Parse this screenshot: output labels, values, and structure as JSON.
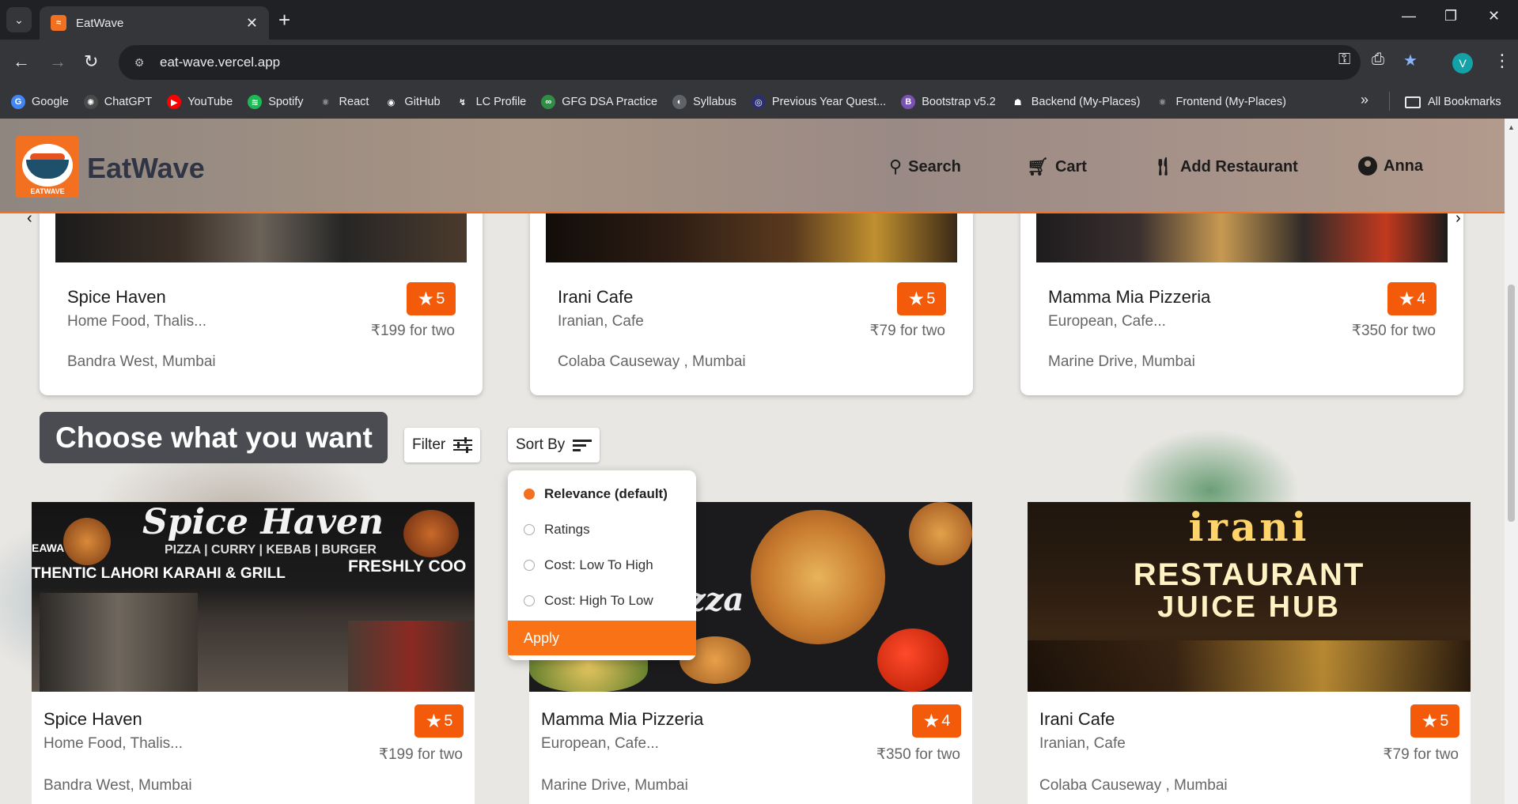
{
  "browser": {
    "tab_title": "EatWave",
    "url": "eat-wave.vercel.app",
    "profile_initial": "V",
    "bookmarks": [
      {
        "label": "Google",
        "color": "#4285f4",
        "glyph": "G"
      },
      {
        "label": "ChatGPT",
        "color": "#4a4a4a",
        "glyph": "✺"
      },
      {
        "label": "YouTube",
        "color": "#ff0000",
        "glyph": "▶"
      },
      {
        "label": "Spotify",
        "color": "#1db954",
        "glyph": "≋"
      },
      {
        "label": "React",
        "color": "#35363a",
        "glyph": "⚛"
      },
      {
        "label": "GitHub",
        "color": "#35363a",
        "glyph": "◉"
      },
      {
        "label": "LC Profile",
        "color": "#35363a",
        "glyph": "↯"
      },
      {
        "label": "GFG DSA Practice",
        "color": "#2f8d46",
        "glyph": "∞"
      },
      {
        "label": "Syllabus",
        "color": "#5f6368",
        "glyph": "◐"
      },
      {
        "label": "Previous Year Quest...",
        "color": "#2b2f6e",
        "glyph": "◎"
      },
      {
        "label": "Bootstrap v5.2",
        "color": "#7952b3",
        "glyph": "B"
      },
      {
        "label": "Backend (My-Places)",
        "color": "#35363a",
        "glyph": "☗"
      },
      {
        "label": "Frontend (My-Places)",
        "color": "#35363a",
        "glyph": "⚛"
      }
    ],
    "all_bookmarks": "All Bookmarks"
  },
  "header": {
    "brand": "EatWave",
    "logo_text": "EATWAVE",
    "nav": {
      "search": "Search",
      "cart": "Cart",
      "add_restaurant": "Add Restaurant",
      "user": "Anna"
    }
  },
  "carousel": [
    {
      "name": "Spice Haven",
      "cuisine": "Home Food, Thalis...",
      "price": "₹199 for two",
      "location": "Bandra West, Mumbai",
      "rating": "5"
    },
    {
      "name": "Irani Cafe",
      "cuisine": "Iranian, Cafe",
      "price": "₹79 for two",
      "location": "Colaba Causeway , Mumbai",
      "rating": "5"
    },
    {
      "name": "Mamma Mia Pizzeria",
      "cuisine": "European, Cafe...",
      "price": "₹350 for two",
      "location": "Marine Drive, Mumbai",
      "rating": "4"
    }
  ],
  "section": {
    "title": "Choose what you want",
    "filter_label": "Filter",
    "sort_label": "Sort By"
  },
  "sort_menu": {
    "options": [
      "Relevance (default)",
      "Ratings",
      "Cost: Low To High",
      "Cost: High To Low"
    ],
    "selected": "Relevance (default)",
    "apply": "Apply"
  },
  "grid": [
    {
      "name": "Spice Haven",
      "cuisine": "Home Food, Thalis...",
      "price": "₹199 for two",
      "location": "Bandra West, Mumbai",
      "rating": "5",
      "sign": {
        "title": "Spice Haven",
        "line1": "PIZZA | CURRY | KEBAB | BURGER",
        "line2": "THENTIC LAHORI KARAHI & GRILL",
        "line3": "FRESHLY COO",
        "line4": "EAWAY"
      }
    },
    {
      "name": "Mamma Mia Pizzeria",
      "cuisine": "European, Cafe...",
      "price": "₹350 for two",
      "location": "Marine Drive, Mumbai",
      "rating": "4",
      "sign": {
        "title": "zza"
      }
    },
    {
      "name": "Irani Cafe",
      "cuisine": "Iranian, Cafe",
      "price": "₹79 for two",
      "location": "Colaba Causeway , Mumbai",
      "rating": "5",
      "sign": {
        "title": "irani",
        "line1": "RESTAURANT",
        "line2": "JUICE HUB"
      }
    }
  ],
  "colors": {
    "accent": "#f37021",
    "rating_badge": "#f35b0b",
    "apply_button": "#f97316"
  }
}
